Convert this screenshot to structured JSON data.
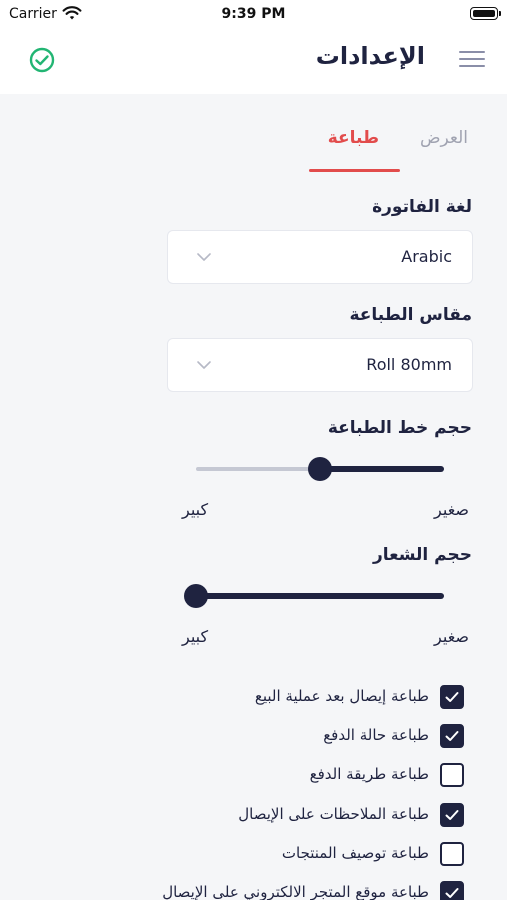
{
  "status_bar": {
    "carrier": "Carrier",
    "time": "9:39 PM"
  },
  "header": {
    "title": "الإعدادات"
  },
  "tabs": {
    "display": "العرض",
    "print": "طباعة"
  },
  "invoice_language": {
    "label": "لغة الفاتورة",
    "value": "Arabic"
  },
  "print_size": {
    "label": "مقاس الطباعة",
    "value": "Roll 80mm"
  },
  "font_size": {
    "label": "حجم خط الطباعة",
    "small": "صغير",
    "large": "كبير",
    "level": 0.5
  },
  "logo_size": {
    "label": "حجم الشعار",
    "small": "صغير",
    "large": "كبير",
    "level": 1.0
  },
  "options": [
    {
      "label": "طباعة إيصال بعد عملية البيع",
      "checked": true
    },
    {
      "label": "طباعة حالة الدفع",
      "checked": true
    },
    {
      "label": "طباعة طريقة الدفع",
      "checked": false
    },
    {
      "label": "طباعة الملاحظات على الإيصال",
      "checked": true
    },
    {
      "label": "طباعة توصيف المنتجات",
      "checked": false
    },
    {
      "label": "طباعة موقع المتجر الالكتروني على الإيصال",
      "checked": true
    }
  ],
  "colors": {
    "accent": "#e24c4c",
    "primary": "#1f2340",
    "success": "#22b573"
  }
}
